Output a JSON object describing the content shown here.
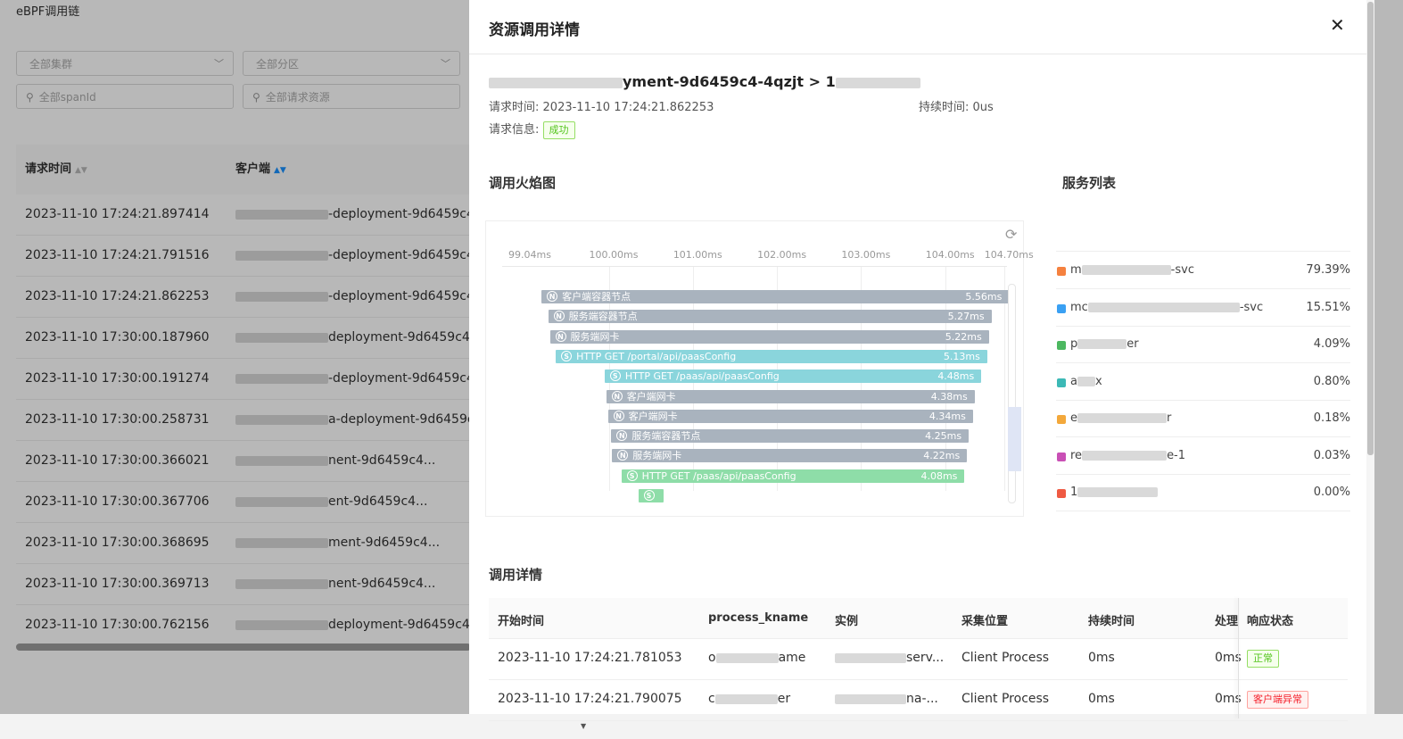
{
  "background": {
    "page_title": "eBPF调用链",
    "filters": {
      "cluster": "全部集群",
      "partition": "全部分区",
      "span_id": "全部spanId",
      "resource": "全部请求资源"
    },
    "columns": [
      "请求时间",
      "客户端"
    ],
    "rows": [
      {
        "time": "2023-11-10 17:24:21.897414",
        "client": "-deployment-9d6459c4..."
      },
      {
        "time": "2023-11-10 17:24:21.791516",
        "client": "-deployment-9d6459c4..."
      },
      {
        "time": "2023-11-10 17:24:21.862253",
        "client": "-deployment-9d6459c4..."
      },
      {
        "time": "2023-11-10 17:30:00.187960",
        "client": "deployment-9d6459c4..."
      },
      {
        "time": "2023-11-10 17:30:00.191274",
        "client": "-deployment-9d6459c4..."
      },
      {
        "time": "2023-11-10 17:30:00.258731",
        "client": "a-deployment-9d6459c4..."
      },
      {
        "time": "2023-11-10 17:30:00.366021",
        "client": "nent-9d6459c4..."
      },
      {
        "time": "2023-11-10 17:30:00.367706",
        "client": "ent-9d6459c4..."
      },
      {
        "time": "2023-11-10 17:30:00.368695",
        "client": "ment-9d6459c4..."
      },
      {
        "time": "2023-11-10 17:30:00.369713",
        "client": "nent-9d6459c4..."
      },
      {
        "time": "2023-11-10 17:30:00.762156",
        "client": "deployment-9d6459c4..."
      }
    ]
  },
  "drawer": {
    "title": "资源调用详情",
    "close_icon": "✕",
    "route_visible": "yment-9d6459c4-4qzjt >",
    "route_tail": "1",
    "request_time_label": "请求时间:",
    "request_time": "2023-11-10 17:24:21.862253",
    "duration_label": "持续时间:",
    "duration": "0us",
    "request_info_label": "请求信息:",
    "request_status": "成功",
    "flame_title": "调用火焰图",
    "service_title": "服务列表",
    "detail_title": "调用详情"
  },
  "flame": {
    "ticks": [
      "99.04ms",
      "100.00ms",
      "101.00ms",
      "102.00ms",
      "103.00ms",
      "104.00ms",
      "104.70ms"
    ],
    "colors": {
      "gray": "#a9b3be",
      "teal": "#8ad5dc",
      "green": "#8edda8"
    },
    "bars": [
      {
        "icon": "N",
        "label": "客户端容器节点",
        "duration": "5.56ms",
        "color": "gray",
        "start": 99.2,
        "end": 104.76
      },
      {
        "icon": "N",
        "label": "服务端容器节点",
        "duration": "5.27ms",
        "color": "gray",
        "start": 99.28,
        "end": 104.55
      },
      {
        "icon": "N",
        "label": "服务端网卡",
        "duration": "5.22ms",
        "color": "gray",
        "start": 99.3,
        "end": 104.52
      },
      {
        "icon": "S",
        "label": "HTTP GET /portal/api/paasConfig",
        "duration": "5.13ms",
        "color": "teal",
        "start": 99.37,
        "end": 104.5
      },
      {
        "icon": "S",
        "label": "HTTP GET /paas/api/paasConfig",
        "duration": "4.48ms",
        "color": "teal",
        "start": 99.95,
        "end": 104.43
      },
      {
        "icon": "N",
        "label": "客户端网卡",
        "duration": "4.38ms",
        "color": "gray",
        "start": 99.97,
        "end": 104.35
      },
      {
        "icon": "N",
        "label": "客户端网卡",
        "duration": "4.34ms",
        "color": "gray",
        "start": 99.99,
        "end": 104.33
      },
      {
        "icon": "N",
        "label": "服务端容器节点",
        "duration": "4.25ms",
        "color": "gray",
        "start": 100.03,
        "end": 104.28
      },
      {
        "icon": "N",
        "label": "服务端网卡",
        "duration": "4.22ms",
        "color": "gray",
        "start": 100.04,
        "end": 104.26
      },
      {
        "icon": "S",
        "label": "HTTP GET /paas/api/paasConfig",
        "duration": "4.08ms",
        "color": "green",
        "start": 100.15,
        "end": 104.23
      },
      {
        "icon": "S",
        "label": "",
        "duration": "",
        "color": "green",
        "start": 100.35,
        "end": 100.65
      }
    ]
  },
  "services": [
    {
      "name_start": "m",
      "name_end": "-svc",
      "percent": "79.39%",
      "color": "#f5813f"
    },
    {
      "name_start": "mc",
      "name_end": "-svc",
      "percent": "15.51%",
      "color": "#3aa0f3"
    },
    {
      "name_start": "p",
      "name_end": "er",
      "percent": "4.09%",
      "color": "#4cb860"
    },
    {
      "name_start": "a",
      "name_end": "x",
      "percent": "0.80%",
      "color": "#3cb9b6"
    },
    {
      "name_start": "e",
      "name_end": "r",
      "percent": "0.18%",
      "color": "#f3a83b"
    },
    {
      "name_start": "re",
      "name_end": "e-1",
      "percent": "0.03%",
      "color": "#c94fb5"
    },
    {
      "name_start": "1",
      "name_end": "",
      "percent": "0.00%",
      "color": "#ef5a43"
    }
  ],
  "details": {
    "columns": [
      "开始时间",
      "process_kname",
      "实例",
      "采集位置",
      "持续时间",
      "处理",
      "响应状态"
    ],
    "rows": [
      {
        "start": "2023-11-10 17:24:21.781053",
        "kname_start": "o",
        "kname_end": "ame",
        "inst_end": "serv...",
        "location": "Client Process",
        "duration": "0ms",
        "handle": "0ms",
        "status": "正常",
        "status_type": "ok"
      },
      {
        "start": "2023-11-10 17:24:21.790075",
        "kname_start": "c",
        "kname_end": "er",
        "inst_end": "na-...",
        "location": "Client Process",
        "duration": "0ms",
        "handle": "0ms",
        "status": "客户端异常",
        "status_type": "err"
      }
    ]
  }
}
